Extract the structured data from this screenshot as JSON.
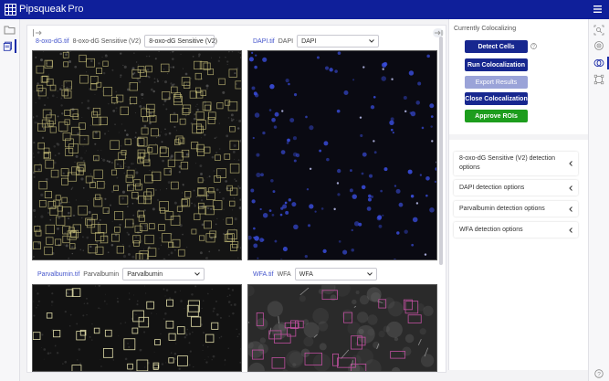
{
  "app": {
    "brand": "Pipsqueak",
    "edition": "Pro"
  },
  "panels": [
    {
      "file": "8-oxo-dG.tif",
      "channel": "8-oxo-dG Sensitive (V2)",
      "selected": "8-oxo-dG Sensitive (V2)"
    },
    {
      "file": "DAPI.tif",
      "channel": "DAPI",
      "selected": "DAPI"
    },
    {
      "file": "Parvalbumin.tif",
      "channel": "Parvalbumin",
      "selected": "Parvalbumin"
    },
    {
      "file": "WFA.tif",
      "channel": "WFA",
      "selected": "WFA"
    }
  ],
  "coloc": {
    "title": "Currently Colocalizing",
    "detect_cells": "Detect Cells",
    "run_coloc": "Run Colocalization",
    "export": "Export Results",
    "close_coloc": "Close Colocalization",
    "approve": "Approve ROIs"
  },
  "detection_options": [
    "8-oxo-dG Sensitive (V2) detection options",
    "DAPI detection options",
    "Parvalbumin detection options",
    "WFA detection options"
  ],
  "colors": {
    "topbar": "#0f1f9a",
    "primary_button": "#17278f",
    "disabled_button": "#9aa3d8",
    "approve_button": "#1d9d1d",
    "roi_8oxo": "#c8c07a",
    "roi_parv": "#e0dca8",
    "roi_wfa": "#c050a0",
    "dapi_nuclei": "#3a4ee0"
  },
  "icons": [
    "grid-logo-icon",
    "hamburger-menu-icon",
    "folder-icon",
    "layers-icon",
    "collapse-left-icon",
    "collapse-right-icon",
    "chevron-down-icon",
    "chevron-left-icon",
    "help-icon",
    "zoom-icon",
    "target-icon",
    "colocalize-icon",
    "crop-icon"
  ]
}
